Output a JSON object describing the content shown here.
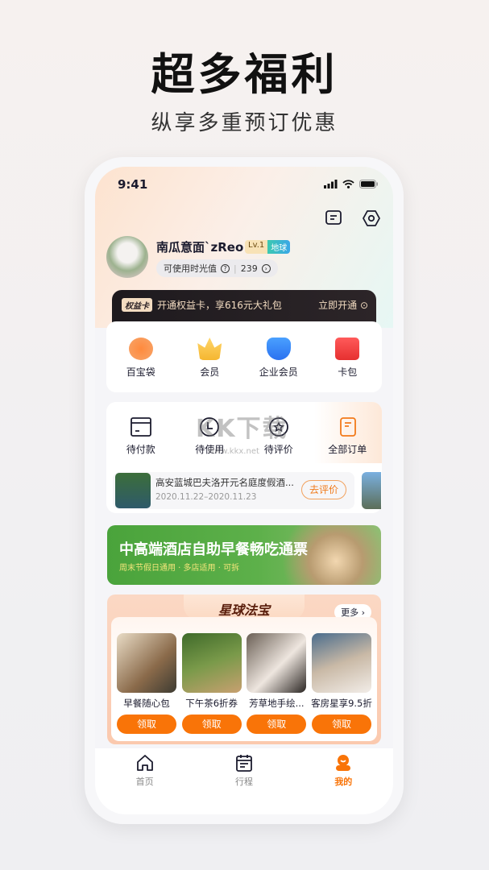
{
  "hero": {
    "title": "超多福利",
    "subtitle": "纵享多重预订优惠"
  },
  "status_bar": {
    "time": "9:41"
  },
  "header": {
    "icons": [
      "message-icon",
      "settings-icon"
    ]
  },
  "profile": {
    "name": "南瓜意面`zReo",
    "level": "Lv.1",
    "level_tag": "地球",
    "points_label": "可使用时光值",
    "points": "239"
  },
  "benefit_card": {
    "badge": "权益卡",
    "text": "开通权益卡，享616元大礼包",
    "cta": "立即开通"
  },
  "quick_menu": [
    {
      "label": "百宝袋",
      "icon": "treasure-bag-icon"
    },
    {
      "label": "会员",
      "icon": "member-crown-icon"
    },
    {
      "label": "企业会员",
      "icon": "enterprise-shield-icon"
    },
    {
      "label": "卡包",
      "icon": "card-wallet-icon"
    }
  ],
  "orders": [
    {
      "label": "待付款",
      "icon": "card-icon"
    },
    {
      "label": "待使用",
      "icon": "clock-icon"
    },
    {
      "label": "待评价",
      "icon": "star-chat-icon"
    },
    {
      "label": "全部订单",
      "icon": "order-list-icon"
    }
  ],
  "pending_review": {
    "hotel": "高安蓝城巴夫洛开元名庭度假酒...",
    "dates": "2020.11.22–2020.11.23",
    "button": "去评价"
  },
  "promo_banner": {
    "title": "中高端酒店自助早餐畅吃通票",
    "subtitle": "周末节假日通用 · 多店适用 · 可拆"
  },
  "treasure": {
    "title": "星球法宝",
    "more": "更多",
    "items": [
      {
        "name": "早餐随心包",
        "button": "领取"
      },
      {
        "name": "下午茶6折券",
        "button": "领取"
      },
      {
        "name": "芳草地手绘...",
        "button": "领取"
      },
      {
        "name": "客房星享9.5折",
        "button": "领取"
      }
    ]
  },
  "tabbar": [
    {
      "label": "首页",
      "icon": "home-icon"
    },
    {
      "label": "行程",
      "icon": "calendar-icon"
    },
    {
      "label": "我的",
      "icon": "profile-icon",
      "active": true
    }
  ],
  "watermark": {
    "text": "KK下载",
    "url": "www.kkx.net"
  },
  "colors": {
    "accent": "#f97408",
    "dark": "#1b1b2e"
  }
}
